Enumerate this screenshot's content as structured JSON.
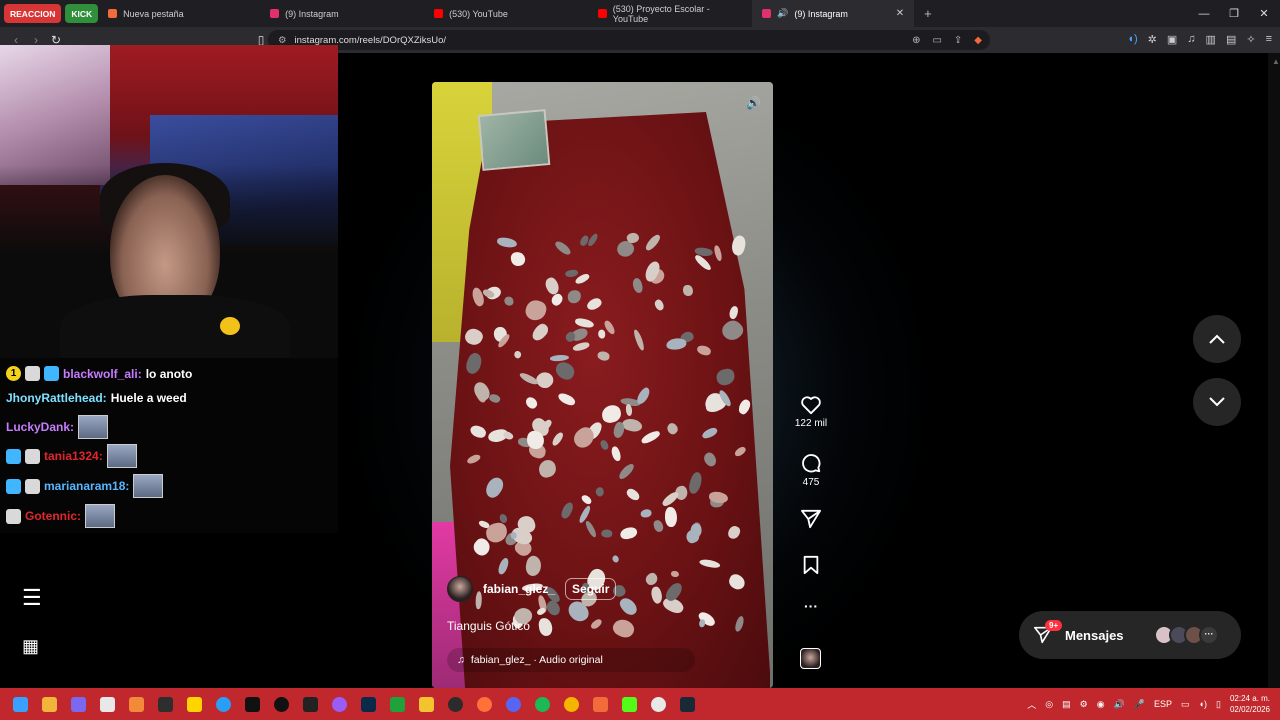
{
  "browser": {
    "tab_groups": [
      {
        "label": "REACCION",
        "color": "#d83636"
      },
      {
        "label": "KICK",
        "color": "#2f8f3a"
      }
    ],
    "tabs": [
      {
        "label": "Nueva pestaña",
        "icon": "brave-icon",
        "color": "#f26b3a"
      },
      {
        "label": "(9) Instagram",
        "icon": "instagram-icon",
        "color": "#e1306c"
      },
      {
        "label": "(530) YouTube",
        "icon": "youtube-icon",
        "color": "#ff0000"
      },
      {
        "label": "(530) Proyecto Escolar - YouTube",
        "icon": "youtube-icon",
        "color": "#ff0000"
      },
      {
        "label": "(9) Instagram",
        "icon": "instagram-icon",
        "color": "#e1306c",
        "active": true
      }
    ],
    "url": "instagram.com/reels/DOrQXZiksUo/"
  },
  "chat": {
    "messages": [
      {
        "user": "blackwolf_ali:",
        "text": "lo anoto",
        "user_color": "#c77dff"
      },
      {
        "user": "JhonyRattlehead:",
        "text": "Huele a weed",
        "user_color": "#7ee0ff"
      },
      {
        "user": "LuckyDank:",
        "text": "",
        "user_color": "#c77dff"
      },
      {
        "user": "tania1324:",
        "text": "",
        "user_color": "#e0262c"
      },
      {
        "user": "marianaram18:",
        "text": "",
        "user_color": "#58b6ff"
      },
      {
        "user": "Gotennic:",
        "text": "",
        "user_color": "#e0262c"
      }
    ]
  },
  "reel": {
    "author": "fabian_glez_",
    "follow_label": "Seguir",
    "caption": "Tianguis Gótico",
    "audio": "fabian_glez_ · Audio original",
    "likes": "122 mil",
    "comments": "475"
  },
  "messages": {
    "label": "Mensajes",
    "count": "9+"
  },
  "taskbar": {
    "language": "ESP",
    "time": "02:24 a. m.",
    "date": "02/02/2026"
  }
}
